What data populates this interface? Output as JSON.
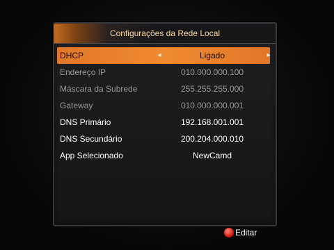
{
  "dialog": {
    "title": "Configurações da Rede Local"
  },
  "settings": [
    {
      "label": "DHCP",
      "value": "Ligado",
      "state": "selected"
    },
    {
      "label": "Endereço IP",
      "value": "010.000.000.100",
      "state": "dim"
    },
    {
      "label": "Máscara da Subrede",
      "value": "255.255.255.000",
      "state": "dim"
    },
    {
      "label": "Gateway",
      "value": "010.000.000.001",
      "state": "dim"
    },
    {
      "label": "DNS Primário",
      "value": "192.168.001.001",
      "state": "bright"
    },
    {
      "label": "DNS Secundário",
      "value": "200.204.000.010",
      "state": "bright"
    },
    {
      "label": "App Selecionado",
      "value": "NewCamd",
      "state": "bright"
    }
  ],
  "footer": {
    "edit_label": "Editar",
    "edit_key_color": "#d21a10"
  },
  "icons": {
    "left_arrow": "◂",
    "right_arrow": "▸"
  },
  "colors": {
    "highlight": "#f08a30",
    "title_text": "#ffd9a0"
  }
}
